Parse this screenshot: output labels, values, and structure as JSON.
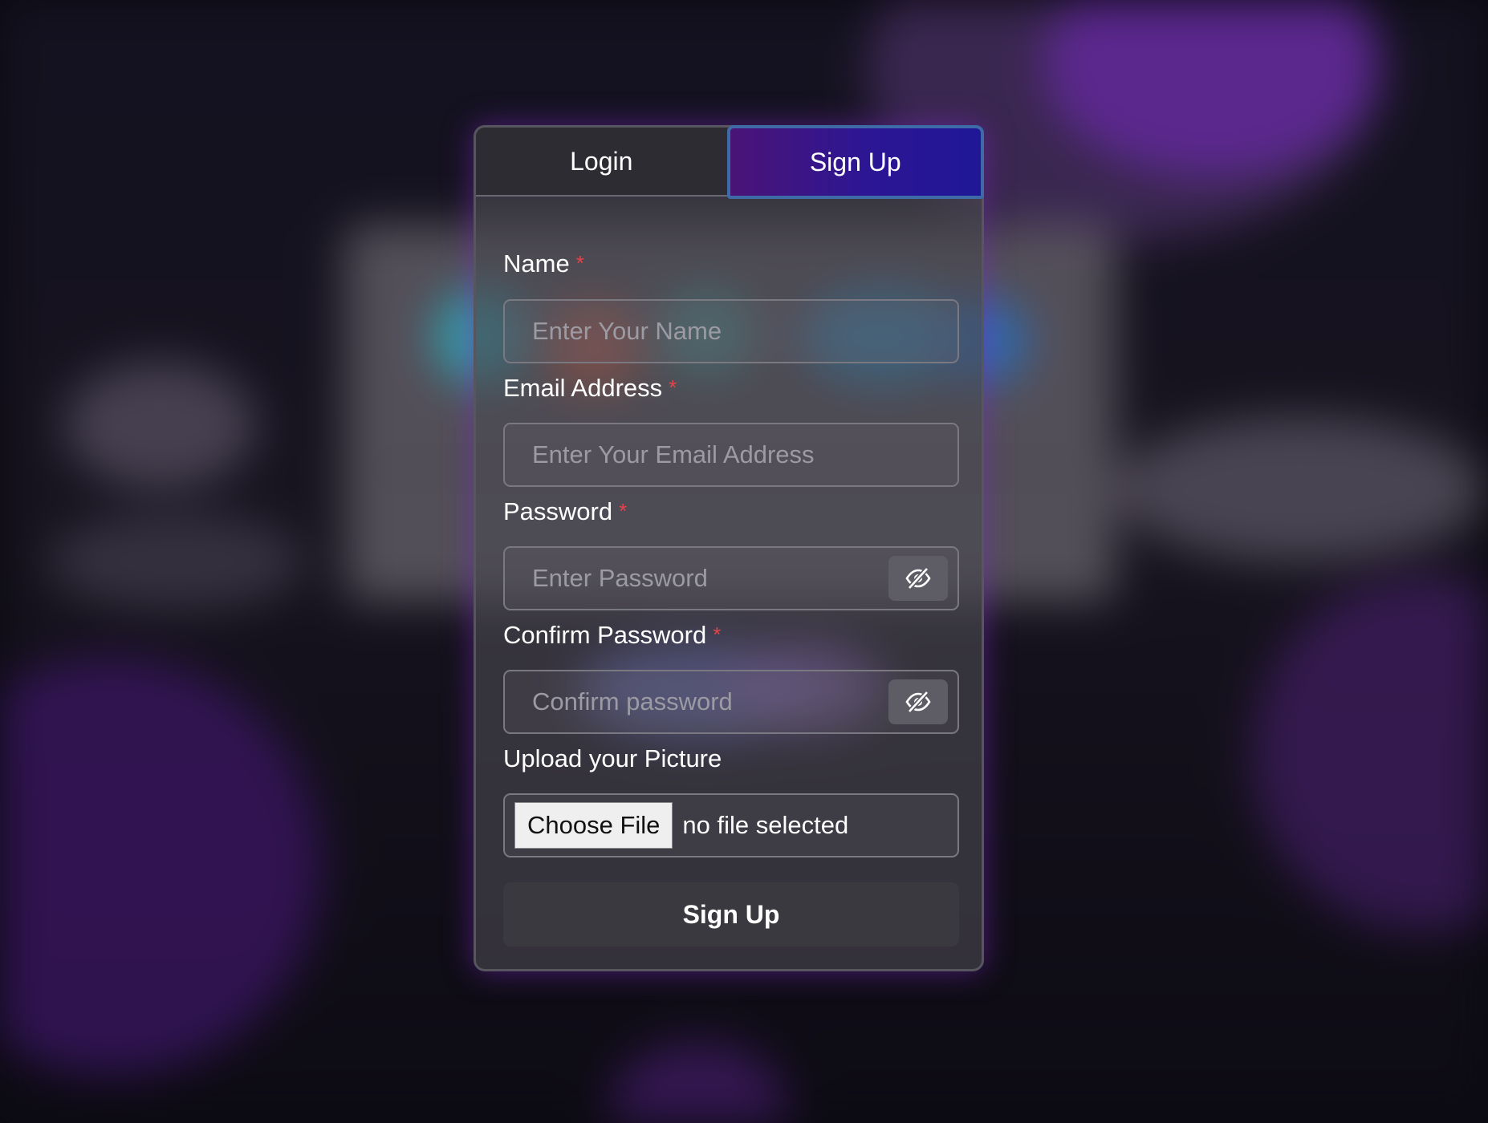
{
  "tabs": {
    "login_label": "Login",
    "signup_label": "Sign Up",
    "active": "Sign Up"
  },
  "form": {
    "name": {
      "label": "Name",
      "required_mark": "*",
      "placeholder": "Enter Your Name",
      "value": ""
    },
    "email": {
      "label": "Email Address",
      "required_mark": "*",
      "placeholder": "Enter Your Email Address",
      "value": ""
    },
    "password": {
      "label": "Password",
      "required_mark": "*",
      "placeholder": "Enter Password",
      "value": "",
      "toggle_icon": "eye-slash-icon"
    },
    "confirm_password": {
      "label": "Confirm Password",
      "required_mark": "*",
      "placeholder": "Confirm password",
      "value": "",
      "toggle_icon": "eye-slash-icon"
    },
    "picture": {
      "label": "Upload your Picture",
      "button_label": "Choose File",
      "status": "no file selected"
    },
    "submit_label": "Sign Up"
  },
  "colors": {
    "accent_gradient_start": "#4a1477",
    "accent_gradient_end": "#1f1796",
    "tab_border": "#3e6aa8",
    "required": "#e5434a",
    "glow": "#7828be"
  }
}
